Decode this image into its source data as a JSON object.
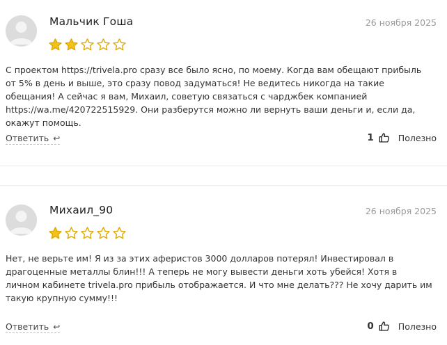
{
  "reviews": [
    {
      "author": "Мальчик Гоша",
      "date": "26 ноября 2025",
      "rating": 2,
      "max_rating": 5,
      "text_before_link": "С проектом https://trivela.pro сразу все было ясно, по моему. Когда вам обещают прибыль от 5% в день и выше, это сразу повод задуматься! Не ведитесь никогда на такие обещания! А сейчас я вам, Михаил, советую связаться с чарджбек компанией ",
      "link": "https://wa.me/420722515929",
      "text_after_link": ". Они разберутся можно ли вернуть ваши деньги и, если да, окажут помощь.",
      "reply_label": "Ответить",
      "helpful_count": "1",
      "helpful_label": "Полезно"
    },
    {
      "author": "Михаил_90",
      "date": "26 ноября 2025",
      "rating": 1,
      "max_rating": 5,
      "text": "Нет, не верьте им! Я из за этих аферистов 3000 долларов потерял! Инвестировал в драгоценные металлы блин!!! А теперь не могу вывести деньги хоть убейся! Хотя в личном кабинете trivela.pro прибыль отображается. И что мне делать??? Не хочу дарить им такую крупную сумму!!!",
      "reply_label": "Ответить",
      "helpful_count": "0",
      "helpful_label": "Полезно"
    }
  ],
  "colors": {
    "star_fill": "#f2c21b",
    "star_stroke": "#e0a800",
    "avatar_bg": "#dcdcdc"
  },
  "icons": {
    "avatar": "user-avatar-icon",
    "star": "star-icon",
    "reply": "reply-arrow-icon",
    "like": "thumbs-up-icon"
  }
}
